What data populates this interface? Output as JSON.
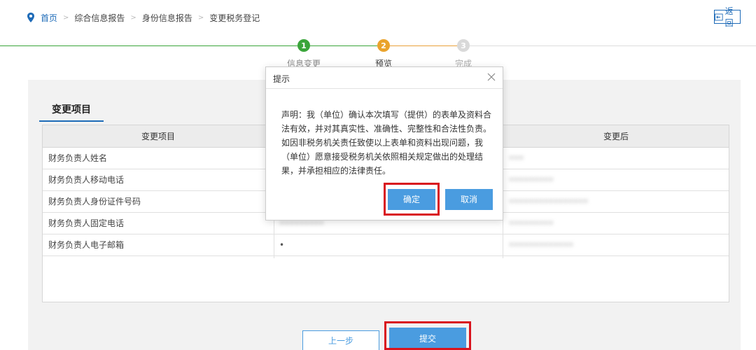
{
  "breadcrumb": {
    "home": "首页",
    "items": [
      "综合信息报告",
      "身份信息报告",
      "变更税务登记"
    ]
  },
  "back_label": "返回",
  "stepper": {
    "steps": [
      {
        "num": "1",
        "label": "信息变更",
        "state": "done"
      },
      {
        "num": "2",
        "label": "预览",
        "state": "current"
      },
      {
        "num": "3",
        "label": "完成",
        "state": "pending"
      }
    ],
    "colors": {
      "done": "#3aa53a",
      "current": "#eaa32c",
      "pending": "#d9d9d9"
    }
  },
  "section_title": "变更项目",
  "table": {
    "headers": [
      "变更项目",
      "",
      "变更后"
    ],
    "rows": [
      {
        "name": "财务负责人姓名",
        "old": "",
        "new": "•••"
      },
      {
        "name": "财务负责人移动电话",
        "old": "",
        "new": "•••••••••"
      },
      {
        "name": "财务负责人身份证件号码",
        "old": "",
        "new": "••••••••••••••••"
      },
      {
        "name": "财务负责人固定电话",
        "old": "•••••••••",
        "new": "•••••••••"
      },
      {
        "name": "财务负责人电子邮箱",
        "old": "•",
        "new": "•••••••••••••"
      }
    ]
  },
  "buttons": {
    "prev": "上一步",
    "submit": "提交"
  },
  "modal": {
    "title": "提示",
    "body": "声明：我（单位）确认本次填写（提供）的表单及资料合法有效，并对其真实性、准确性、完整性和合法性负责。如因非税务机关责任致使以上表单和资料出现问题，我（单位）愿意接受税务机关依照相关规定做出的处理结果，并承担相应的法律责任。",
    "ok": "确定",
    "cancel": "取消"
  },
  "colors": {
    "accent": "#1e6bb8",
    "button": "#4a9ce0",
    "highlight": "#d9141e"
  }
}
